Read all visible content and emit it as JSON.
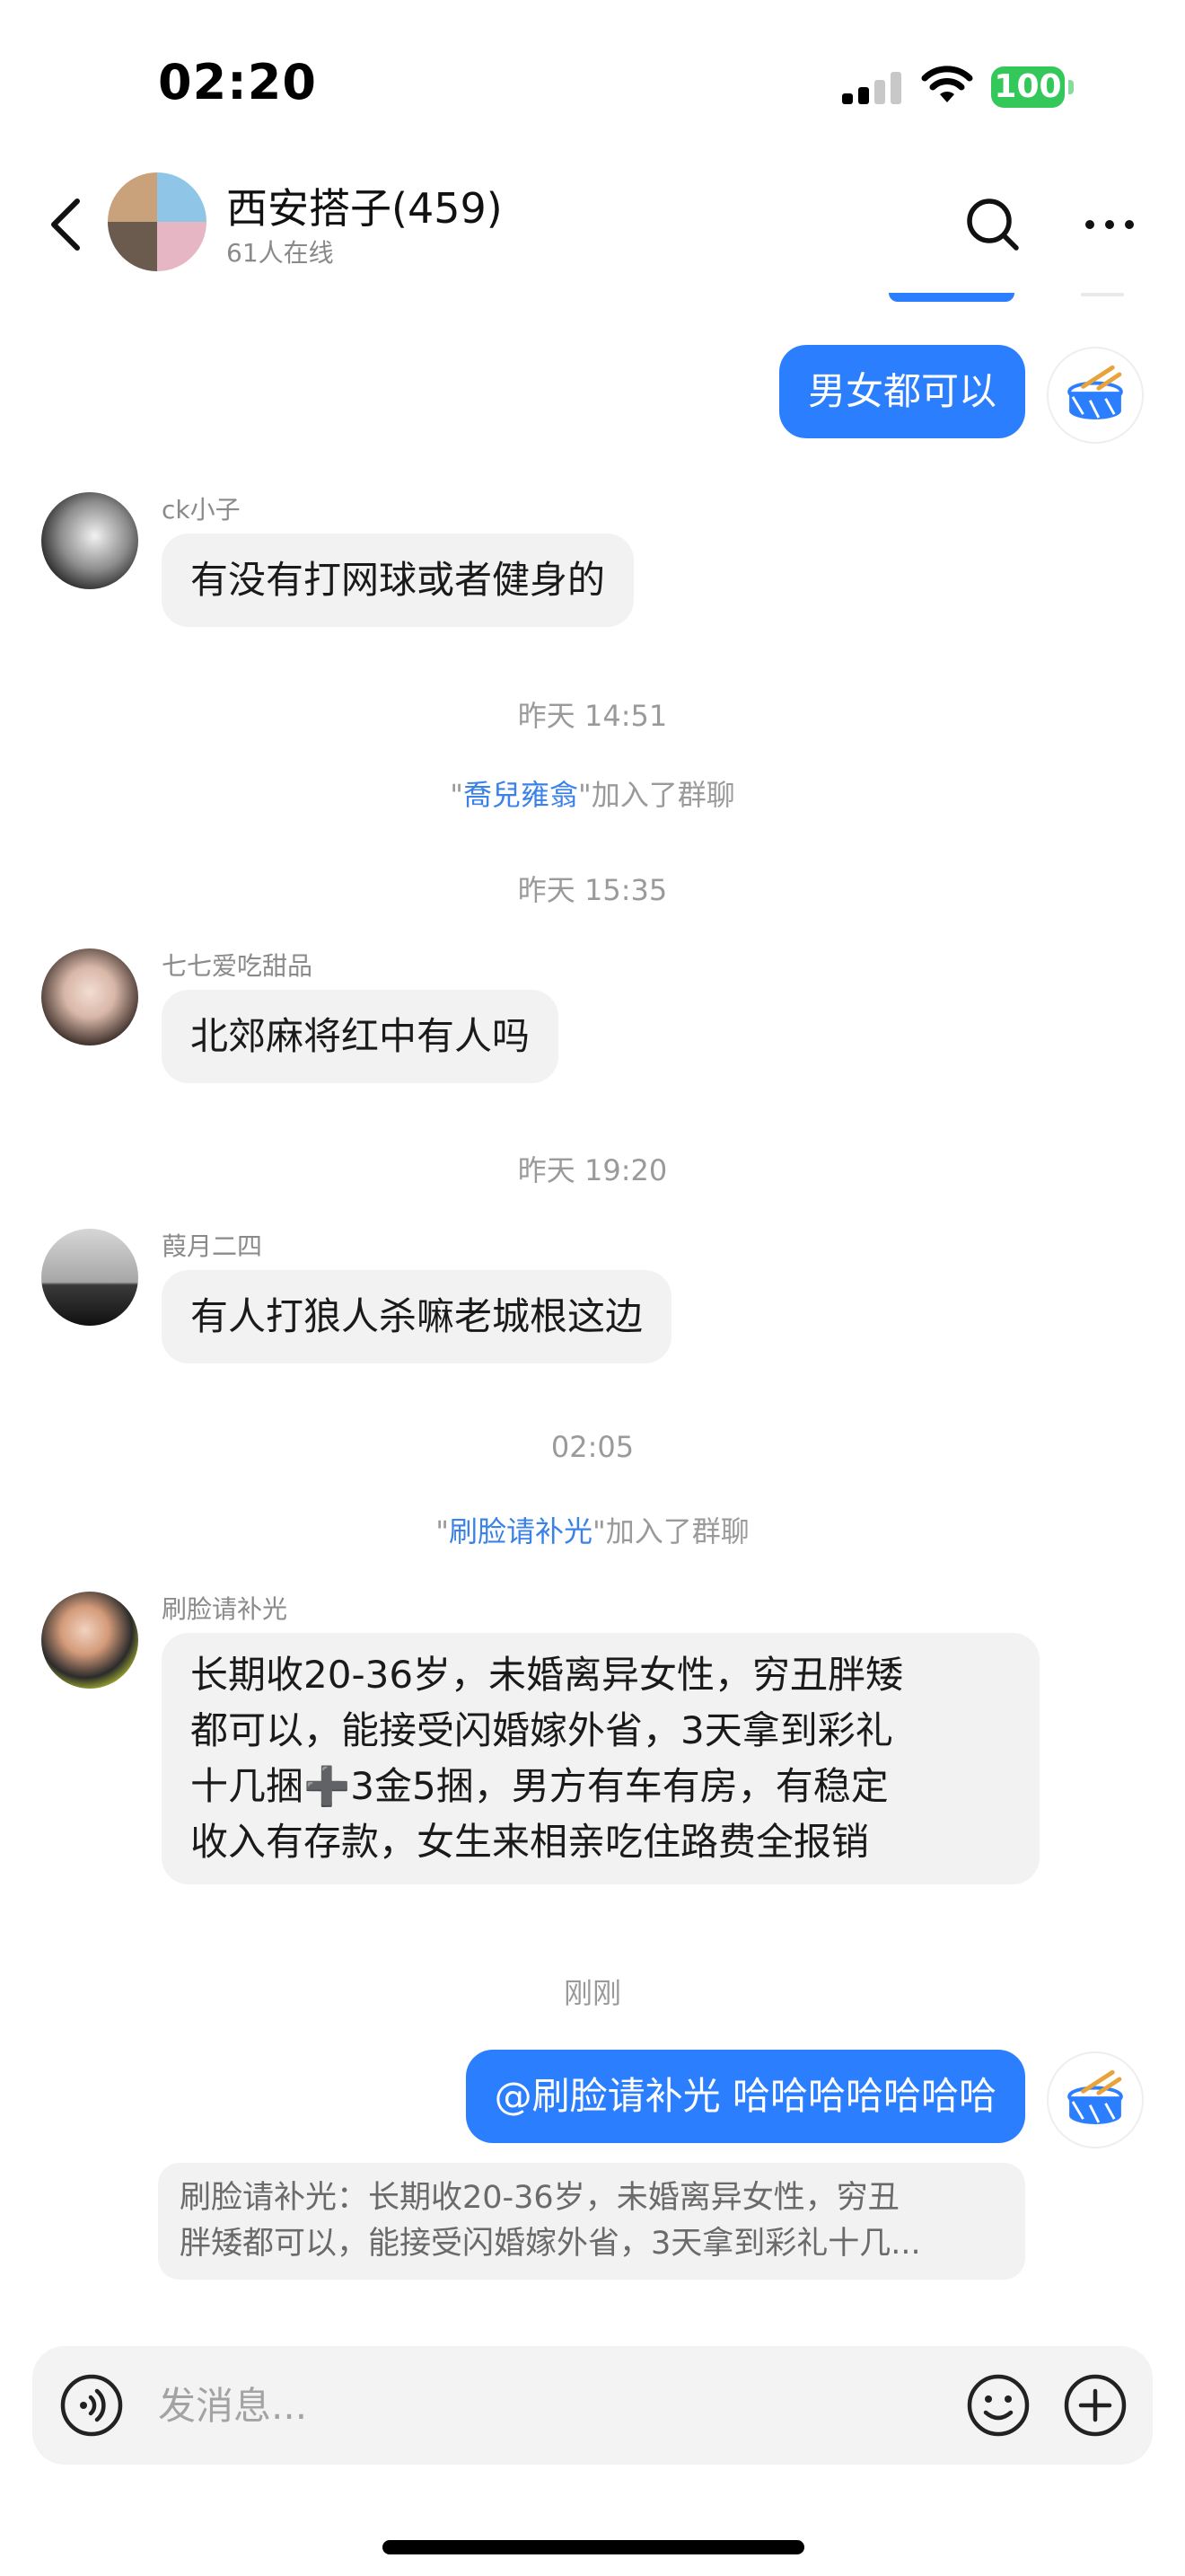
{
  "status_bar": {
    "time": "02:20",
    "battery": "100",
    "battery_color": "#34c759"
  },
  "header": {
    "back_icon": "chevron-left-icon",
    "title": "西安搭子(459)",
    "subtitle": "61人在线",
    "search_icon": "search-icon",
    "more_icon": "more-dots-icon"
  },
  "colors": {
    "accent": "#2b7fff",
    "incoming_bubble": "#f2f2f2",
    "link_name": "#3a82e8"
  },
  "messages": {
    "m1": {
      "text": "男女都可以",
      "side": "out"
    },
    "m2": {
      "sender": "ck小子",
      "text": "有没有打网球或者健身的"
    },
    "t1": "昨天 14:51",
    "j1": {
      "open": "\"",
      "name": "喬兒雍翕",
      "close": "\"加入了群聊"
    },
    "t2": "昨天 15:35",
    "m3": {
      "sender": "七七爱吃甜品",
      "text": "北郊麻将红中有人吗"
    },
    "t3": "昨天 19:20",
    "m4": {
      "sender": "葭月二四",
      "text": "有人打狼人杀嘛老城根这边"
    },
    "t4": "02:05",
    "j2": {
      "open": "\"",
      "name": "刷脸请补光",
      "close": "\"加入了群聊"
    },
    "m5": {
      "sender": "刷脸请补光",
      "lines": [
        "长期收20-36岁，未婚离异女性，穷丑胖矮",
        "都可以，能接受闪婚嫁外省，3天拿到彩礼",
        "十几捆➕3金5捆，男方有车有房，有稳定",
        "收入有存款，女生来相亲吃住路费全报销"
      ]
    },
    "t5": "刚刚",
    "m6": {
      "text": "@刷脸请补光 哈哈哈哈哈哈哈",
      "side": "out"
    },
    "quote": {
      "lines": [
        "刷脸请补光：长期收20-36岁，未婚离异女性，穷丑",
        "胖矮都可以，能接受闪婚嫁外省，3天拿到彩礼十几..."
      ]
    }
  },
  "composer": {
    "placeholder": "发消息...",
    "value": "",
    "voice_icon": "voice-icon",
    "emoji_icon": "emoji-icon",
    "plus_icon": "plus-circle-icon"
  }
}
